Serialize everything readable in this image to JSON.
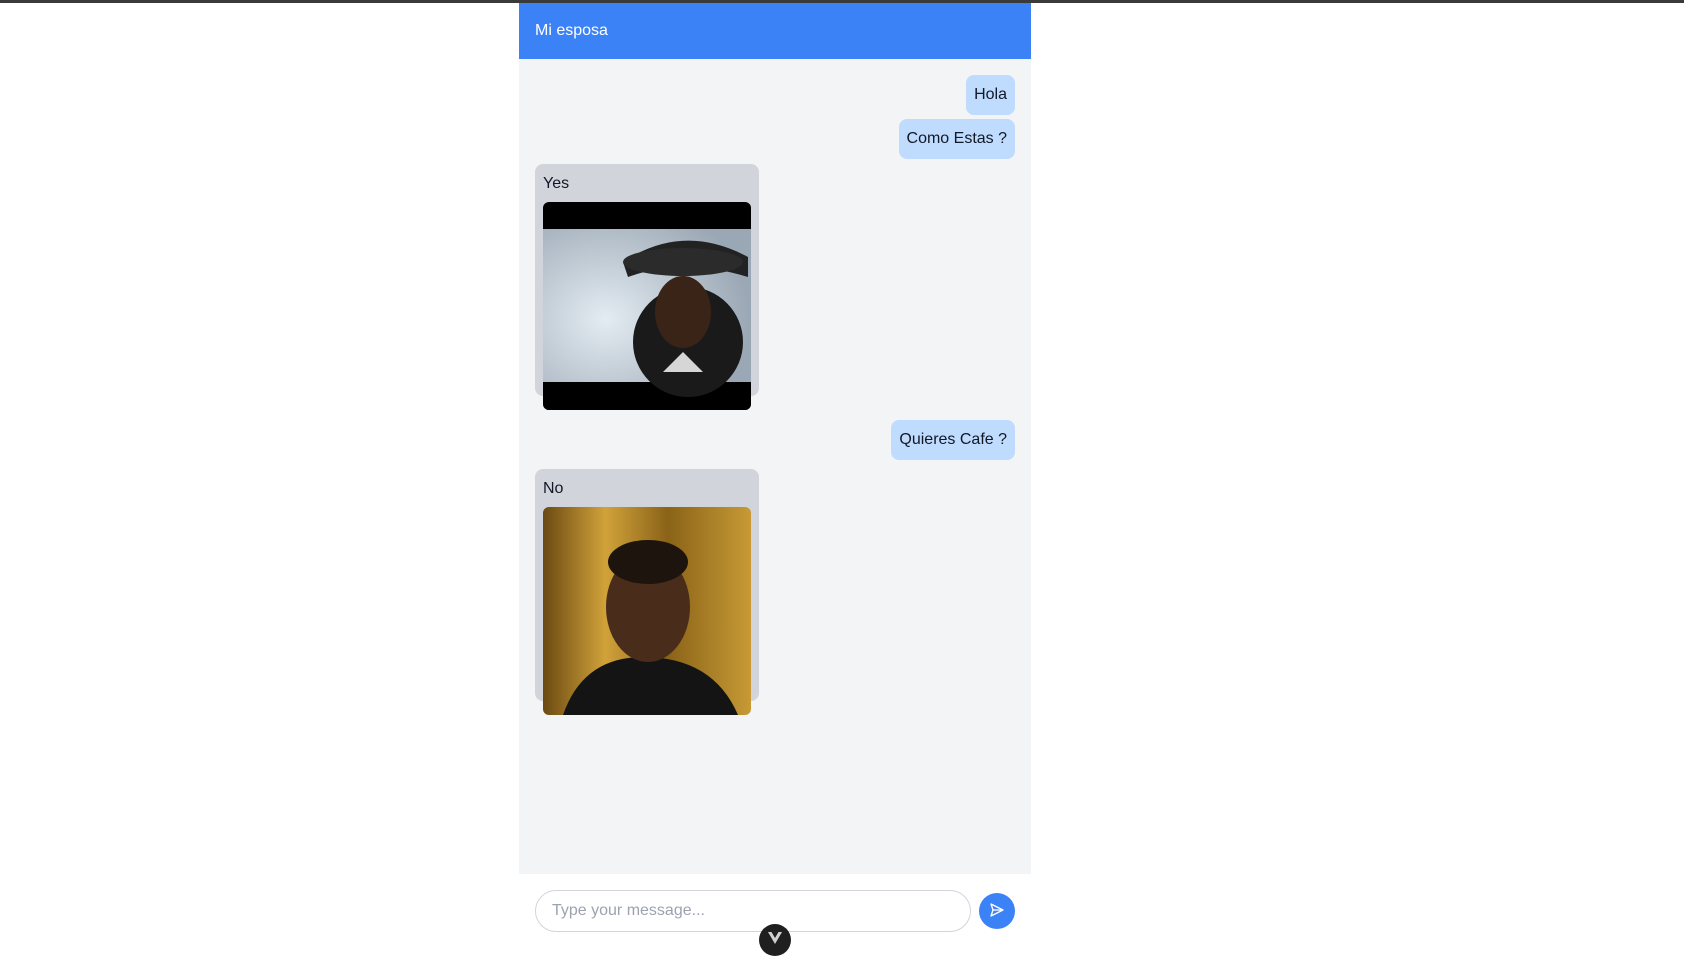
{
  "header": {
    "title": "Mi esposa"
  },
  "messages": {
    "m1": "Hola",
    "m2": "Como Estas ?",
    "m3": "Yes",
    "m4": "Quieres Cafe ?",
    "m5": "No"
  },
  "composer": {
    "placeholder": "Type your message..."
  },
  "icons": {
    "send": "send-icon",
    "devtools": "vue-devtools-icon"
  },
  "colors": {
    "header": "#3b82f6",
    "outgoing_bubble": "#bfdbfe",
    "incoming_bubble": "#d1d5db",
    "chat_background": "#f3f4f6"
  }
}
